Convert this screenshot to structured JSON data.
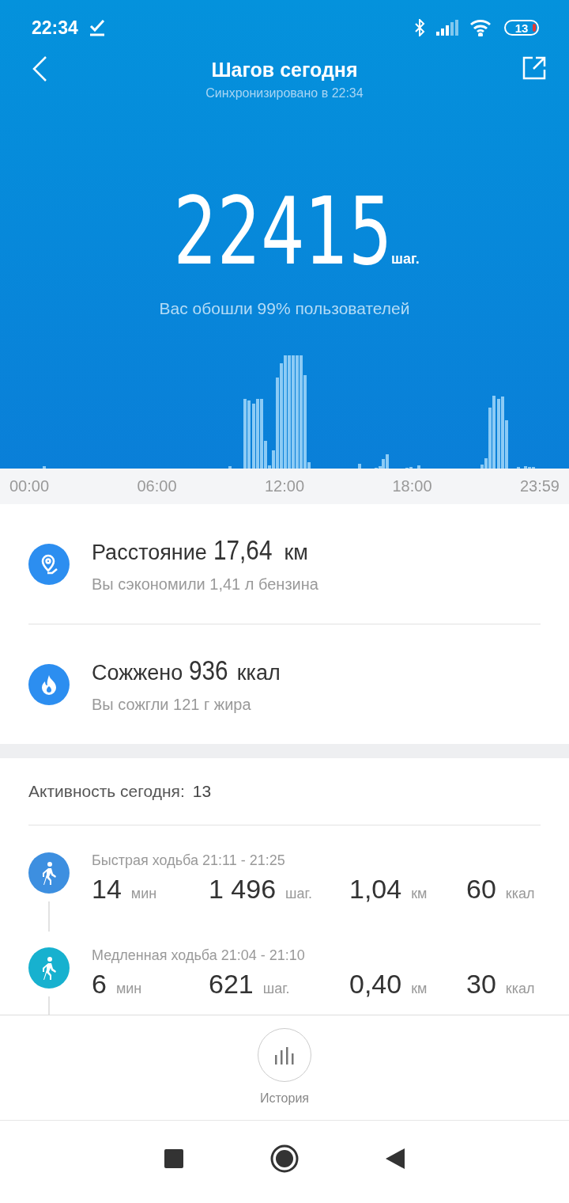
{
  "status_bar": {
    "time": "22:34",
    "battery": "13"
  },
  "header": {
    "title": "Шагов сегодня",
    "subtitle": "Синхронизировано в 22:34"
  },
  "hero": {
    "steps": "22415",
    "unit": "шаг.",
    "rank": "Вас обошли 99% пользователей"
  },
  "time_axis": [
    "00:00",
    "06:00",
    "12:00",
    "18:00",
    "23:59"
  ],
  "summary": [
    {
      "kind": "distance",
      "label": "Расстояние",
      "value": "17,64",
      "unit": "км",
      "note": "Вы сэкономили 1,41 л бензина"
    },
    {
      "kind": "calories",
      "label": "Сожжено",
      "value": "936",
      "unit": "ккал",
      "note": "Вы сожгли 121 г жира"
    }
  ],
  "activity": {
    "title": "Активность сегодня:",
    "count": "13",
    "items": [
      {
        "title": "Быстрая ходьба 21:11 - 21:25",
        "color": "#3d8fe0",
        "stats": [
          {
            "value": "14",
            "unit": "мин"
          },
          {
            "value": "1 496",
            "unit": "шаг."
          },
          {
            "value": "1,04",
            "unit": "км"
          },
          {
            "value": "60",
            "unit": "ккал"
          }
        ]
      },
      {
        "title": "Медленная ходьба 21:04 - 21:10",
        "color": "#17b1cf",
        "stats": [
          {
            "value": "6",
            "unit": "мин"
          },
          {
            "value": "621",
            "unit": "шаг."
          },
          {
            "value": "0,40",
            "unit": "км"
          },
          {
            "value": "30",
            "unit": "ккал"
          }
        ]
      }
    ]
  },
  "bottom": {
    "history": "История"
  }
}
